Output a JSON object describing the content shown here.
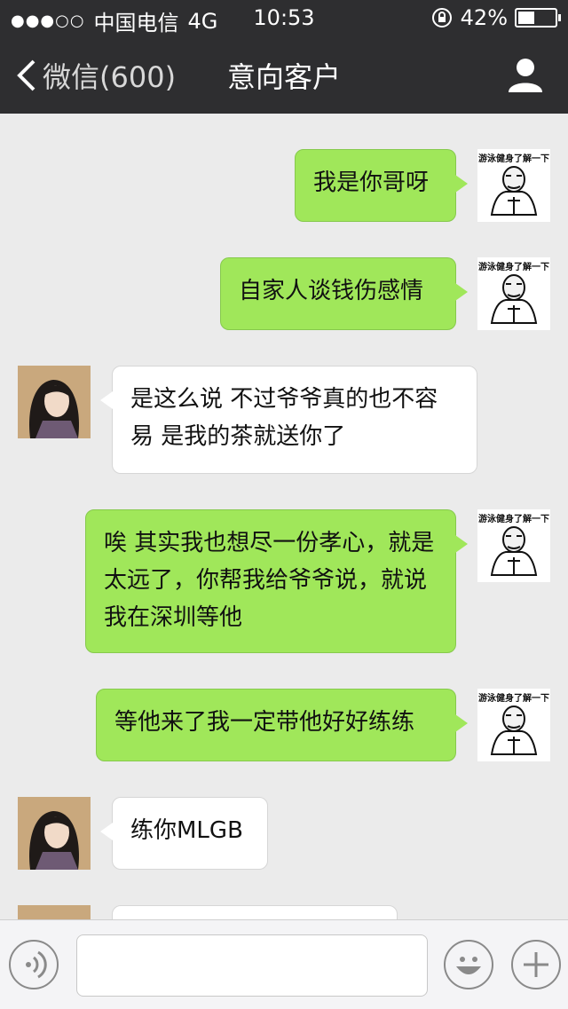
{
  "status": {
    "signal": "●●●○○",
    "carrier": "中国电信",
    "network": "4G",
    "time": "10:53",
    "battery": "42%",
    "battery_level": 0.42
  },
  "nav": {
    "back_label": "微信(600)",
    "title": "意向客户"
  },
  "sticker_caption": "游泳健身了解一下",
  "messages": [
    {
      "side": "out",
      "text": "我是你哥呀"
    },
    {
      "side": "out",
      "text": "自家人谈钱伤感情"
    },
    {
      "side": "in",
      "text": "是这么说 不过爷爷真的也不容易 是我的茶就送你了"
    },
    {
      "side": "out",
      "text": "唉 其实我也想尽一份孝心，就是太远了，你帮我给爷爷说，就说我在深圳等他"
    },
    {
      "side": "out",
      "text": "等他来了我一定带他好好练练"
    },
    {
      "side": "in",
      "text": "练你MLGB"
    },
    {
      "side": "in",
      "text": ""
    }
  ],
  "colors": {
    "bar": "#2e2e30",
    "background": "#ebebeb",
    "outgoing_bubble": "#a0e75a",
    "incoming_bubble": "#ffffff"
  }
}
